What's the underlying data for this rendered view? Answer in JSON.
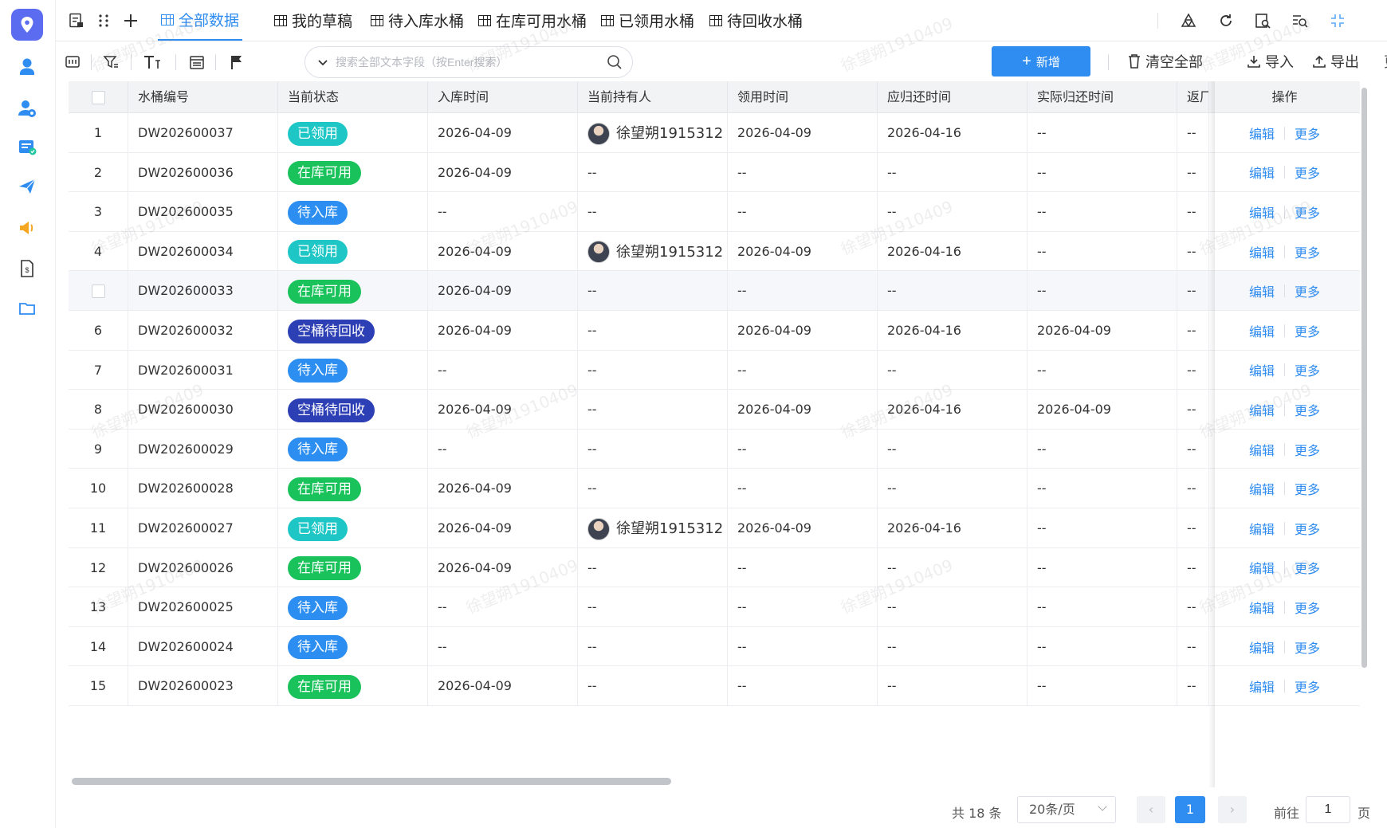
{
  "colors": {
    "primary": "#2f8cf0",
    "status": {
      "已领用": "#1fc6c6",
      "在库可用": "#19c25a",
      "待入库": "#2b8ef0",
      "空桶待回收": "#2d3fb5"
    }
  },
  "rail": {
    "logo_icon": "location-pin-icon",
    "items": [
      {
        "icon": "user-pin-icon"
      },
      {
        "icon": "user-settings-icon"
      },
      {
        "icon": "card-check-icon"
      },
      {
        "icon": "send-icon"
      },
      {
        "icon": "speaker-icon"
      },
      {
        "icon": "dollar-doc-icon"
      },
      {
        "icon": "folder-icon"
      }
    ]
  },
  "tabs": [
    {
      "label": "全部数据",
      "active": true
    },
    {
      "label": "我的草稿",
      "active": false
    },
    {
      "label": "待入库水桶",
      "active": false
    },
    {
      "label": "在库可用水桶",
      "active": false
    },
    {
      "label": "已领用水桶",
      "active": false
    },
    {
      "label": "待回收水桶",
      "active": false
    }
  ],
  "toolbar": {
    "search_placeholder": "搜索全部文本字段（按Enter搜索）",
    "add_label": "新增",
    "clear_label": "清空全部",
    "import_label": "导入",
    "export_label": "导出",
    "more_label": "更多"
  },
  "table": {
    "columns": [
      "水桶编号",
      "当前状态",
      "入库时间",
      "当前持有人",
      "领用时间",
      "应归还时间",
      "实际归还时间",
      "返厂",
      "操作"
    ],
    "edit_label": "编辑",
    "more_label": "更多",
    "rows": [
      {
        "idx": "1",
        "code": "DW202600037",
        "status": "已领用",
        "in_time": "2026-04-09",
        "holder": "徐望朔1915312",
        "take_time": "2026-04-09",
        "due_time": "2026-04-16",
        "return_time": "--",
        "factory": "--"
      },
      {
        "idx": "2",
        "code": "DW202600036",
        "status": "在库可用",
        "in_time": "2026-04-09",
        "holder": "--",
        "take_time": "--",
        "due_time": "--",
        "return_time": "--",
        "factory": "--"
      },
      {
        "idx": "3",
        "code": "DW202600035",
        "status": "待入库",
        "in_time": "--",
        "holder": "--",
        "take_time": "--",
        "due_time": "--",
        "return_time": "--",
        "factory": "--"
      },
      {
        "idx": "4",
        "code": "DW202600034",
        "status": "已领用",
        "in_time": "2026-04-09",
        "holder": "徐望朔1915312",
        "take_time": "2026-04-09",
        "due_time": "2026-04-16",
        "return_time": "--",
        "factory": "--"
      },
      {
        "idx": "",
        "code": "DW202600033",
        "status": "在库可用",
        "in_time": "2026-04-09",
        "holder": "--",
        "take_time": "--",
        "due_time": "--",
        "return_time": "--",
        "factory": "--"
      },
      {
        "idx": "6",
        "code": "DW202600032",
        "status": "空桶待回收",
        "in_time": "2026-04-09",
        "holder": "--",
        "take_time": "2026-04-09",
        "due_time": "2026-04-16",
        "return_time": "2026-04-09",
        "factory": "--"
      },
      {
        "idx": "7",
        "code": "DW202600031",
        "status": "待入库",
        "in_time": "--",
        "holder": "--",
        "take_time": "--",
        "due_time": "--",
        "return_time": "--",
        "factory": "--"
      },
      {
        "idx": "8",
        "code": "DW202600030",
        "status": "空桶待回收",
        "in_time": "2026-04-09",
        "holder": "--",
        "take_time": "2026-04-09",
        "due_time": "2026-04-16",
        "return_time": "2026-04-09",
        "factory": "--"
      },
      {
        "idx": "9",
        "code": "DW202600029",
        "status": "待入库",
        "in_time": "--",
        "holder": "--",
        "take_time": "--",
        "due_time": "--",
        "return_time": "--",
        "factory": "--"
      },
      {
        "idx": "10",
        "code": "DW202600028",
        "status": "在库可用",
        "in_time": "2026-04-09",
        "holder": "--",
        "take_time": "--",
        "due_time": "--",
        "return_time": "--",
        "factory": "--"
      },
      {
        "idx": "11",
        "code": "DW202600027",
        "status": "已领用",
        "in_time": "2026-04-09",
        "holder": "徐望朔1915312",
        "take_time": "2026-04-09",
        "due_time": "2026-04-16",
        "return_time": "--",
        "factory": "--"
      },
      {
        "idx": "12",
        "code": "DW202600026",
        "status": "在库可用",
        "in_time": "2026-04-09",
        "holder": "--",
        "take_time": "--",
        "due_time": "--",
        "return_time": "--",
        "factory": "--"
      },
      {
        "idx": "13",
        "code": "DW202600025",
        "status": "待入库",
        "in_time": "--",
        "holder": "--",
        "take_time": "--",
        "due_time": "--",
        "return_time": "--",
        "factory": "--"
      },
      {
        "idx": "14",
        "code": "DW202600024",
        "status": "待入库",
        "in_time": "--",
        "holder": "--",
        "take_time": "--",
        "due_time": "--",
        "return_time": "--",
        "factory": "--"
      },
      {
        "idx": "15",
        "code": "DW202600023",
        "status": "在库可用",
        "in_time": "2026-04-09",
        "holder": "--",
        "take_time": "--",
        "due_time": "--",
        "return_time": "--",
        "factory": "--"
      }
    ]
  },
  "pagination": {
    "total_label": "共 18 条",
    "page_size_label": "20条/页",
    "current_page": "1",
    "goto_label": "前往",
    "goto_value": "1",
    "page_unit": "页"
  },
  "watermark": "徐望朔1910409"
}
